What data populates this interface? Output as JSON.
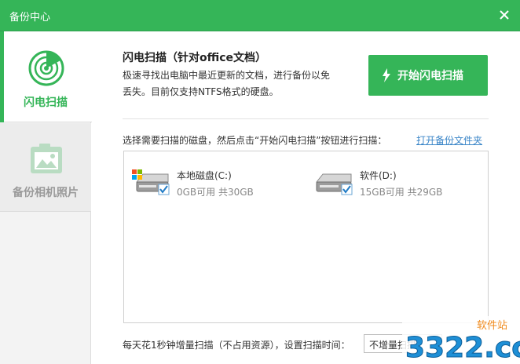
{
  "window": {
    "title": "备份中心"
  },
  "sidebar": {
    "items": [
      {
        "label": "闪电扫描",
        "active": true,
        "icon": "radar-scan-icon"
      },
      {
        "label": "备份相机照片",
        "active": false,
        "icon": "camera-photo-icon"
      }
    ]
  },
  "main": {
    "heading": "闪电扫描（针对office文档）",
    "description": "极速寻找出电脑中最近更新的文档，进行备份以免丢失。目前仅支持NTFS格式的硬盘。",
    "start_button_label": "开始闪电扫描",
    "instruction": "选择需要扫描的磁盘，然后点击“开始闪电扫描”按钮进行扫描：",
    "open_folder_link": "打开备份文件夹",
    "disks": [
      {
        "name": "本地磁盘(C:)",
        "info": "0GB可用 共30GB",
        "checked": true,
        "system": true
      },
      {
        "name": "软件(D:)",
        "info": "15GB可用 共29GB",
        "checked": true,
        "system": false
      }
    ],
    "schedule_text": "每天花1秒钟增量扫描（不占用资源），设置扫描时间：",
    "schedule_select_value": "不增量扫描"
  },
  "watermark": {
    "text": "3322.cc",
    "subtext": "软件站"
  },
  "colors": {
    "accent": "#35b558",
    "link": "#3b86c8",
    "watermark_blue": "#1e8fd6",
    "watermark_orange": "#f08a1c"
  }
}
